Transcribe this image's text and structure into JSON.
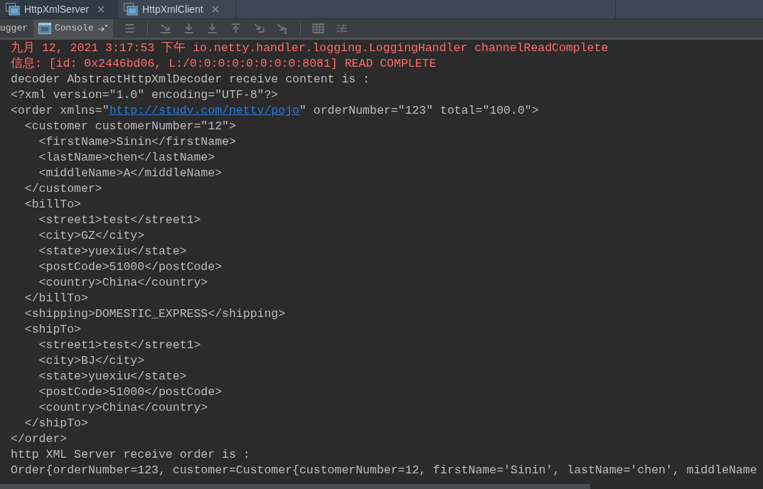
{
  "editor_tabs": [
    {
      "label": "HttpXmlServer",
      "selected": true
    },
    {
      "label": "HttpXmlClient",
      "selected": false
    }
  ],
  "tool_tabs": [
    {
      "label": "ugger",
      "selected": false
    },
    {
      "label": "Console",
      "selected": true
    }
  ],
  "console_lines": [
    {
      "kind": "error",
      "text": "九月 12, 2021 3:17:53 下午 io.netty.handler.logging.LoggingHandler channelReadComplete"
    },
    {
      "kind": "error",
      "text": "信息: [id: 0x2446bd06, L:/0:0:0:0:0:0:0:0:8081] READ COMPLETE"
    },
    {
      "kind": "plain",
      "text": "decoder AbstractHttpXmlDecoder receive content is :"
    },
    {
      "kind": "plain",
      "text": "<?xml version=\"1.0\" encoding=\"UTF-8\"?>"
    },
    {
      "kind": "link",
      "before": "<order xmlns=\"",
      "link": "http://study.com/netty/pojo",
      "after": "\" orderNumber=\"123\" total=\"100.0\">"
    },
    {
      "kind": "plain",
      "text": "  <customer customerNumber=\"12\">"
    },
    {
      "kind": "plain",
      "text": "    <firstName>Sinin</firstName>"
    },
    {
      "kind": "plain",
      "text": "    <lastName>chen</lastName>"
    },
    {
      "kind": "plain",
      "text": "    <middleName>A</middleName>"
    },
    {
      "kind": "plain",
      "text": "  </customer>"
    },
    {
      "kind": "plain",
      "text": "  <billTo>"
    },
    {
      "kind": "plain",
      "text": "    <street1>test</street1>"
    },
    {
      "kind": "plain",
      "text": "    <city>GZ</city>"
    },
    {
      "kind": "plain",
      "text": "    <state>yuexiu</state>"
    },
    {
      "kind": "plain",
      "text": "    <postCode>51000</postCode>"
    },
    {
      "kind": "plain",
      "text": "    <country>China</country>"
    },
    {
      "kind": "plain",
      "text": "  </billTo>"
    },
    {
      "kind": "plain",
      "text": "  <shipping>DOMESTIC_EXPRESS</shipping>"
    },
    {
      "kind": "plain",
      "text": "  <shipTo>"
    },
    {
      "kind": "plain",
      "text": "    <street1>test</street1>"
    },
    {
      "kind": "plain",
      "text": "    <city>BJ</city>"
    },
    {
      "kind": "plain",
      "text": "    <state>yuexiu</state>"
    },
    {
      "kind": "plain",
      "text": "    <postCode>51000</postCode>"
    },
    {
      "kind": "plain",
      "text": "    <country>China</country>"
    },
    {
      "kind": "plain",
      "text": "  </shipTo>"
    },
    {
      "kind": "plain",
      "text": "</order>"
    },
    {
      "kind": "plain",
      "text": "http XML Server receive order is :"
    },
    {
      "kind": "plain",
      "text": "Order{orderNumber=123, customer=Customer{customerNumber=12, firstName='Sinin', lastName='chen', middleName"
    }
  ]
}
